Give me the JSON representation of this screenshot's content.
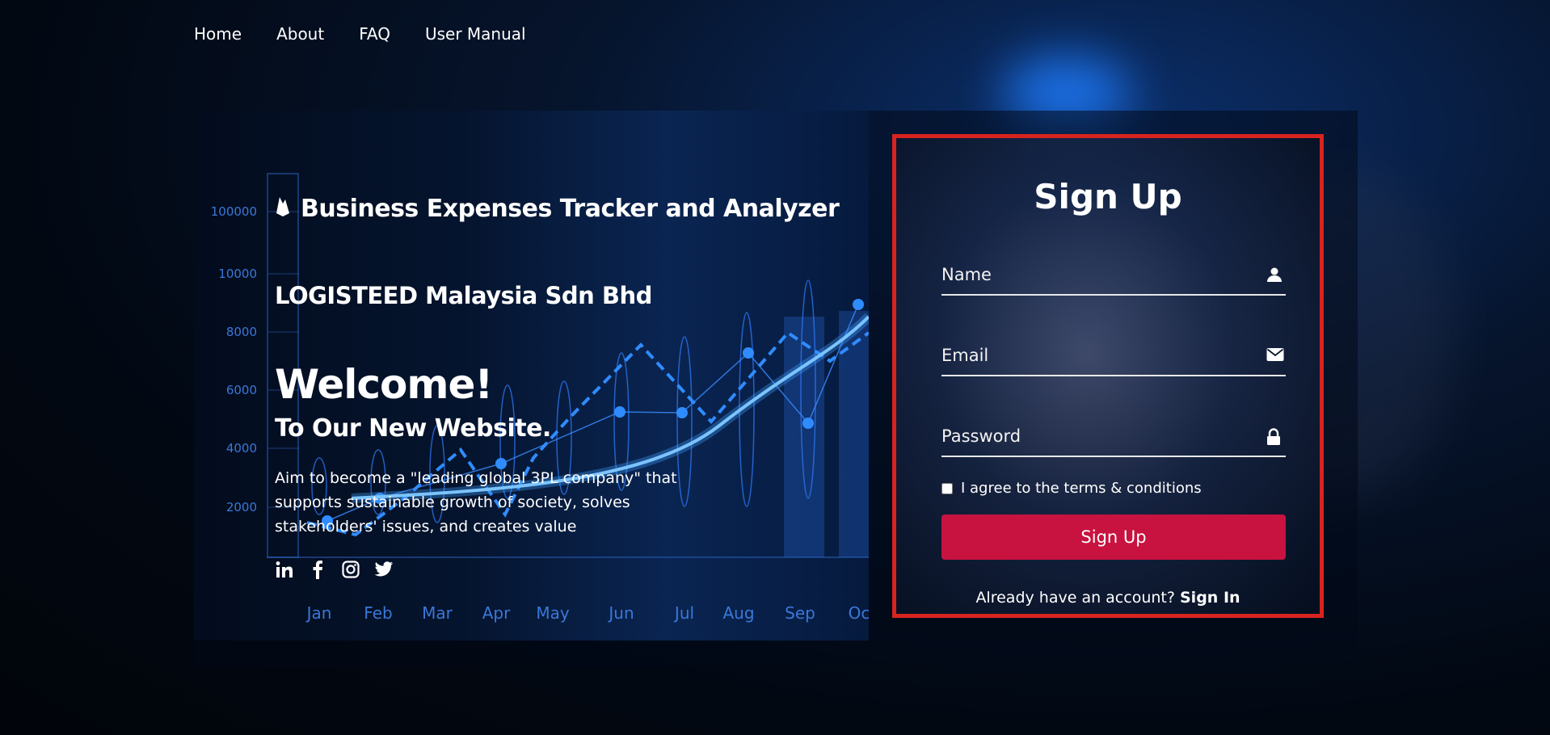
{
  "nav": {
    "items": [
      "Home",
      "About",
      "FAQ",
      "User Manual"
    ]
  },
  "brand": {
    "title": "Business Expenses Tracker and Analyzer",
    "icon": "firebase-flame-icon"
  },
  "company": "LOGISTEED Malaysia Sdn Bhd",
  "hero": {
    "welcome": "Welcome!",
    "subtitle": "To Our New Website.",
    "description": "Aim to become a \"leading global 3PL company\" that supports sustainable growth of society, solves stakeholders' issues, and creates value"
  },
  "social": [
    "linkedin-icon",
    "facebook-icon",
    "instagram-icon",
    "twitter-icon"
  ],
  "bg_chart": {
    "yticks": [
      "100000",
      "10000",
      "8000",
      "6000",
      "4000",
      "2000"
    ],
    "months": [
      "Jan",
      "Feb",
      "Mar",
      "Apr",
      "May",
      "Jun",
      "Jul",
      "Aug",
      "Sep",
      "Oc"
    ]
  },
  "signup": {
    "title": "Sign Up",
    "name_placeholder": "Name",
    "email_placeholder": "Email",
    "password_placeholder": "Password",
    "agree_label": "I agree to the terms & conditions",
    "button_label": "Sign Up",
    "already_text": "Already have an account?",
    "signin_link": "Sign In"
  },
  "colors": {
    "accent": "#c8123f",
    "highlight_border": "#d8231f"
  }
}
